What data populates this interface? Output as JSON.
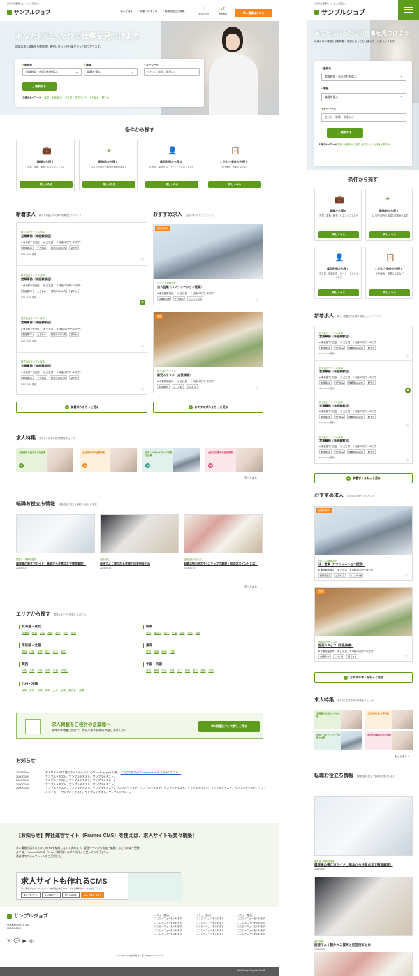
{
  "site": {
    "tagline": "日本の仕事探しを、もっと身近に。",
    "logo": "サンプルジョブ"
  },
  "nav": {
    "items": [
      "求人を探す",
      "特集・おすすめ",
      "転職お役立ち情報"
    ],
    "favorites": "お気に入り",
    "history": "閲覧履歴",
    "post_button": "求人掲載はこちら"
  },
  "hero": {
    "title": "あなたにぴったりの仕事を見つけよう",
    "subtitle": "地域の求人情報を多数掲載！希望に合ったお仕事がきっと見つかります。",
    "search": {
      "location_label": "勤務地",
      "location_value": "都道府県・市区町村を選ぶ",
      "occupation_label": "職種",
      "occupation_value": "職種を選ぶ",
      "keyword_label": "キーワード",
      "keyword_placeholder": "会社名、職種、業種など",
      "button": "検索する",
      "popular_label": "人気のキーワード",
      "popular": [
        "事務",
        "未経験OK",
        "正社員",
        "在宅ワーク",
        "土日休み",
        "駅チカ"
      ]
    }
  },
  "conditions": {
    "title": "条件から探す",
    "items": [
      {
        "title": "職種から探す",
        "desc": "営業、事務、販売、ITエンジニアなど",
        "button": "詳しくみる",
        "icon": "briefcase-icon"
      },
      {
        "title": "勤務地から探す",
        "desc": "エリアや駅から希望の勤務地を探す",
        "button": "詳しくみる",
        "icon": "map-pin-icon"
      },
      {
        "title": "雇用形態から探す",
        "desc": "正社員、契約社員、パート・アルバイトなど",
        "button": "詳しくみる",
        "icon": "user-check-icon"
      },
      {
        "title": "こだわり条件から探す",
        "desc": "土日休み、残業少なめなど",
        "button": "詳しくみる",
        "icon": "clipboard-check-icon"
      }
    ]
  },
  "new_jobs": {
    "title": "新着求人",
    "sub": "新しく掲載された求人情報をピックアップ！",
    "items": [
      {
        "company": "株式会社サンプル商事",
        "title": "営業事務（未経験歓迎）",
        "loc": "東京都千代田区",
        "type": "正社員",
        "salary": "月給22万円〜28万円",
        "tags": [
          "未経験OK",
          "土日休み",
          "残業月10h以内",
          "駅チカ"
        ],
        "date": "5/23 10:00 更新",
        "fav": false
      },
      {
        "company": "株式会社サンプル商事",
        "title": "営業事務（未経験歓迎）",
        "loc": "東京都千代田区",
        "type": "正社員",
        "salary": "月給22万円〜28万円",
        "tags": [
          "未経験OK",
          "土日休み",
          "残業月10h以内",
          "駅チカ"
        ],
        "date": "5/23 10:00 更新",
        "fav": true
      },
      {
        "company": "株式会社サンプル商事",
        "title": "営業事務（未経験歓迎）",
        "loc": "東京都千代田区",
        "type": "正社員",
        "salary": "月給22万円〜28万円",
        "tags": [
          "未経験OK",
          "土日休み",
          "残業月10h以内",
          "駅チカ"
        ],
        "date": "5/23 10:00 更新",
        "fav": false
      },
      {
        "company": "株式会社サンプル商事",
        "title": "営業事務（未経験歓迎）",
        "loc": "東京都千代田区",
        "type": "正社員",
        "salary": "月給22万円〜28万円",
        "tags": [
          "未経験OK",
          "土日休み",
          "残業月10h以内",
          "駅チカ"
        ],
        "date": "5/23 10:00 更新",
        "fav": false
      }
    ],
    "more": "新着求人をもっと見る"
  },
  "recommended": {
    "title": "おすすめ求人",
    "sub": "注目の求人をピックアップ！",
    "items": [
      {
        "badge": "積極採用中",
        "company": "サンプル情報会社",
        "title": "法人営業（ITソリューション提案）",
        "loc": "東京都新宿区",
        "type": "正社員",
        "salary": "月給30万円〜45万円",
        "tags": [
          "経験者優遇",
          "土日休み",
          "フレックス制"
        ]
      },
      {
        "badge": "急募",
        "company": "株式会社サンプル",
        "title": "販売スタッフ（店長候補）",
        "loc": "千葉県船橋市",
        "type": "正社員",
        "salary": "月給24万円〜30万円",
        "tags": [
          "未経験OK",
          "シフト制",
          "賞与あり"
        ]
      }
    ],
    "more": "おすすめ求人をもっと見る"
  },
  "features": {
    "title": "求人特集",
    "sub": "あなたにおすすめの特集をチェック！",
    "items": [
      "未経験から始めれるお仕事",
      "土日休みのお仕事特集",
      "在宅・リモートワーク可能な仕事",
      "女性が活躍中の会社特集"
    ],
    "more": "もっとみる"
  },
  "columns": {
    "title": "転職お役立ち情報",
    "sub": "転職活動に役立つ情報をお届けします！",
    "items": [
      {
        "cat": "履歴書・職務経歴書",
        "title": "履歴書の書き方ガイド：基本から注意点まで徹底解説！",
        "date": "2024/05/20"
      },
      {
        "cat": "面接対策",
        "title": "面接でよく聞かれる質問と回答例まとめ",
        "date": "2024/05/18"
      },
      {
        "cat": "転職活動の進め方",
        "title": "転職活動の流れを5ステップで解説｜成功のポイントとは？",
        "date": "2024/05/15"
      }
    ],
    "more": "もっとみる"
  },
  "areas": {
    "title": "エリアから探す",
    "sub": "希望のエリアを選択してください",
    "groups": [
      {
        "name": "北海道・東北",
        "items": [
          "北海道",
          "青森",
          "岩手",
          "宮城",
          "秋田",
          "山形",
          "福島"
        ]
      },
      {
        "name": "関東",
        "items": [
          "東京",
          "神奈川",
          "埼玉",
          "千葉",
          "茨城",
          "栃木",
          "群馬"
        ]
      },
      {
        "name": "甲信越・北陸",
        "items": [
          "新潟",
          "山梨",
          "長野",
          "富山",
          "石川",
          "福井"
        ]
      },
      {
        "name": "東海",
        "items": [
          "愛知",
          "岐阜",
          "静岡",
          "三重"
        ]
      },
      {
        "name": "関西",
        "items": [
          "大阪",
          "兵庫",
          "京都",
          "滋賀",
          "奈良",
          "和歌山"
        ]
      },
      {
        "name": "中国・四国",
        "items": [
          "鳥取",
          "島根",
          "岡山",
          "広島",
          "山口",
          "徳島",
          "香川",
          "愛媛",
          "高知"
        ]
      },
      {
        "name": "九州・沖縄",
        "items": [
          "福岡",
          "佐賀",
          "長崎",
          "熊本",
          "大分",
          "宮崎",
          "鹿児島",
          "沖縄"
        ]
      }
    ]
  },
  "banner": {
    "title": "求人掲載をご検討の企業様へ",
    "sub": "地域の求職者に向けて、貴社の求人情報を掲載しませんか？",
    "button": "求人掲載について詳しく見る"
  },
  "news": {
    "title": "お知らせ",
    "items": [
      {
        "date": "2026/06/●●",
        "text": "求人サイト向け 無料ホームページテンプレート tp_job5 公開。",
        "link": "ご利用の際は必ず readme.htmlをお読みください。"
      },
      {
        "date": "2000/00/00",
        "text": "サンプルテキスト。サンプルテキスト。サンプルテキスト。",
        "link": ""
      },
      {
        "date": "2000/00/00",
        "text": "サンプルテキスト。サンプルテキスト。サンプルテキスト。",
        "link": ""
      },
      {
        "date": "2000/00/00",
        "text": "サンプルテキスト。サンプルテキスト。サンプルテキスト。",
        "link": ""
      },
      {
        "date": "2000/00/00",
        "text": "サンプルテキスト。サンプルテキスト。サンプルテキスト。サンプルテキスト。サンプルテキスト。サンプルテキスト。サンプルテキスト。サンプルテキスト。サンプルテキスト。サンプルテキスト。サンプルテキスト。サンプルテキスト。サンプルテキスト。",
        "link": ""
      }
    ]
  },
  "cms": {
    "title": "【お知らせ】弊社運営サイト（Frames CMS）を使えば、求人サイトも楽々構築！",
    "lines": [
      "求人情報が増えるたびにHTMLを編集しなくて済みます。管理ページから追加・編集するだけの楽々更新。",
      "まずは、Frames CMS の「Free（無料版）の求人向け」を使ってみて下さい。",
      "業者様のクライアントへのご活用にも。"
    ],
    "link_text": "Frames CMS",
    "box_title": "求人サイトも作れるCMS",
    "box_sub": "初心者様でもカンタンにサイトを構築できるCMS。まずは無料のFreeをお試し下さい。",
    "box_buttons": [
      "求人一覧ページ",
      "求人詳細ページ",
      "絞り込み検索",
      "Free（無料）版あり"
    ]
  },
  "footer": {
    "logo": "サンプルジョブ",
    "address": [
      "東京都XXXXXXビル1F",
      "03-0000-0000"
    ],
    "sns": [
      "x-icon",
      "line-icon",
      "youtube-icon",
      "instagram-icon"
    ],
    "menus": [
      {
        "title": "メニュー見出し",
        "items": [
          "ここにメニューを入れます",
          "ここにメニューを入れます",
          "ここにメニューを入れます",
          "ここにメニューを入れます",
          "ここにメニューを入れます"
        ]
      },
      {
        "title": "メニュー見出し",
        "items": [
          "ここにメニューを入れます",
          "ここにメニューを入れます",
          "ここにメニューを入れます",
          "ここにメニューを入れます",
          "ここにメニューを入れます"
        ]
      },
      {
        "title": "メニュー見出し",
        "items": [
          "ここにメニューを入れます",
          "ここにメニューを入れます",
          "ここにメニューを入れます",
          "ここにメニューを入れます",
          "ここにメニューを入れます"
        ]
      }
    ],
    "copyright": "Copyright© あなたのサイト名 All Rights Reserved.",
    "credit": "Web Design Template PixSD"
  },
  "mobile": {
    "hero_title": "あなたにぴったりの仕事を見つけよう",
    "hero_sub": "地域の求人情報を多数掲載！希望に合ったお仕事がきっと見つかります。"
  },
  "colors": {
    "accent": "#5e9c1e",
    "orange": "#f5891f"
  }
}
